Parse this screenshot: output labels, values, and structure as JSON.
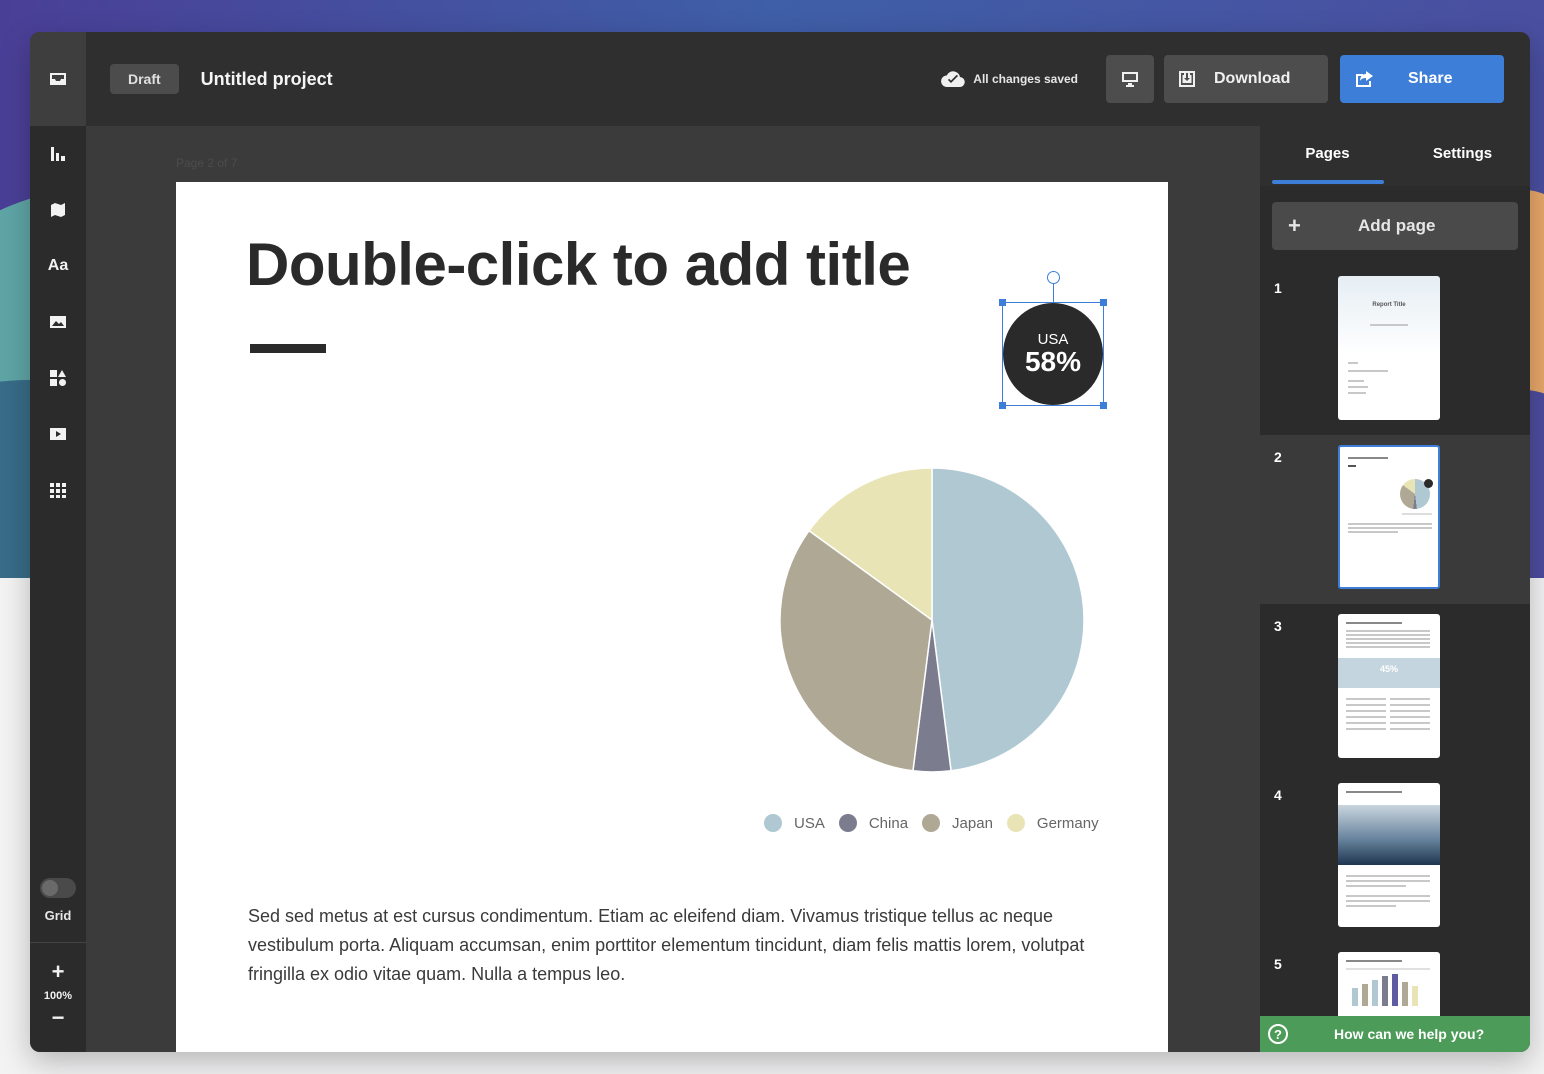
{
  "header": {
    "status_badge": "Draft",
    "project_title": "Untitled project",
    "save_status": "All changes saved",
    "download_label": "Download",
    "share_label": "Share"
  },
  "sidebar": {
    "tools": [
      "chart-icon",
      "map-icon",
      "text-icon",
      "image-icon",
      "shapes-icon",
      "video-icon",
      "table-icon"
    ],
    "text_tool_label": "Aa",
    "grid_label": "Grid",
    "zoom_in": "+",
    "zoom_level": "100%",
    "zoom_out": "−"
  },
  "canvas": {
    "page_label": "Page 2 of 7",
    "title": "Double-click to add title",
    "badge": {
      "country": "USA",
      "value": "58%"
    },
    "body": "Sed sed metus at est cursus condimentum. Etiam ac eleifend diam. Vivamus tristique tellus ac neque vestibulum porta. Aliquam accumsan, enim porttitor elementum tincidunt, diam felis mattis lorem, volutpat fringilla ex odio vitae quam. Nulla a tempus leo."
  },
  "chart_data": {
    "type": "pie",
    "categories": [
      "USA",
      "China",
      "Japan",
      "Germany"
    ],
    "values": [
      48,
      4,
      33,
      15
    ],
    "colors": [
      "#afc8d2",
      "#7b7d8e",
      "#aea895",
      "#e8e4b6"
    ],
    "legend": "bottom-right"
  },
  "panel": {
    "tabs": [
      "Pages",
      "Settings"
    ],
    "active_tab": "Pages",
    "add_page_label": "Add page",
    "pages": [
      "1",
      "2",
      "3",
      "4",
      "5"
    ],
    "active_page": "2",
    "thumb1_title": "Report Title",
    "thumb3_value": "45%",
    "help_label": "How can we help you?"
  }
}
